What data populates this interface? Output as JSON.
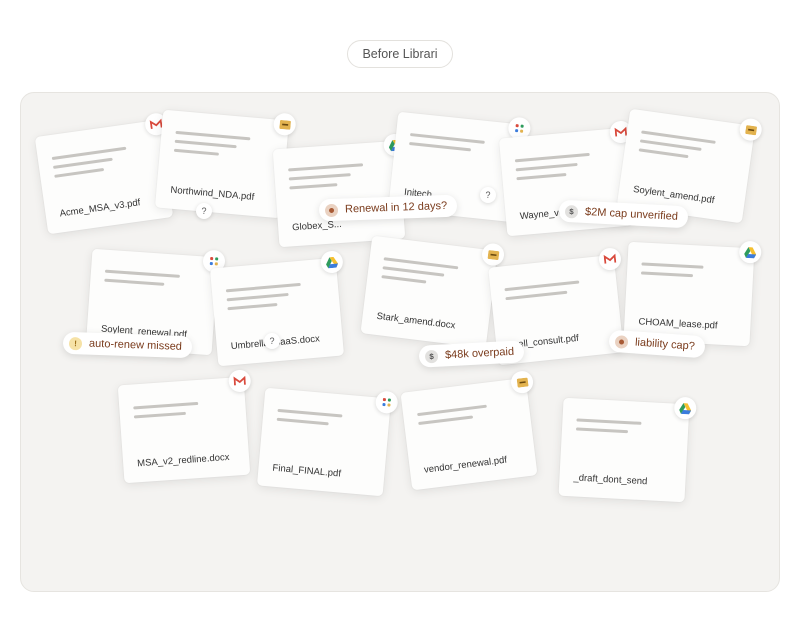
{
  "header": {
    "label": "Before Librari"
  },
  "cards": [
    {
      "filename": "Acme_MSA_v3.pdf",
      "source_icon": "gmail-icon"
    },
    {
      "filename": "Northwind_NDA.pdf",
      "source_icon": "box-icon"
    },
    {
      "filename": "Globex_S...",
      "source_icon": "google-drive-icon"
    },
    {
      "filename": "Initech...",
      "source_icon": "slack-icon"
    },
    {
      "filename": "Wayne_ver...",
      "source_icon": "gmail-icon"
    },
    {
      "filename": "Soylent_amend.pdf",
      "source_icon": "box-icon"
    },
    {
      "filename": "Soylent_renewal.pdf",
      "source_icon": "slack-icon"
    },
    {
      "filename": "Umbrella_SaaS.docx",
      "source_icon": "google-drive-icon"
    },
    {
      "filename": "Stark_amend.docx",
      "source_icon": "box-icon"
    },
    {
      "filename": "...ell_consult.pdf",
      "source_icon": "gmail-icon"
    },
    {
      "filename": "CHOAM_lease.pdf",
      "source_icon": "google-drive-icon"
    },
    {
      "filename": "MSA_v2_redline.docx",
      "source_icon": "gmail-icon"
    },
    {
      "filename": "Final_FINAL.pdf",
      "source_icon": "slack-icon"
    },
    {
      "filename": "vendor_renewal.pdf",
      "source_icon": "box-icon"
    },
    {
      "filename": "_draft_dont_send",
      "source_icon": "google-drive-icon"
    }
  ],
  "alerts": [
    {
      "text": "Renewal in 12 days?",
      "icon": "bell-icon"
    },
    {
      "text": "$2M cap unverified",
      "icon": "dollar-icon"
    },
    {
      "text": "auto-renew missed",
      "icon": "warning-icon"
    },
    {
      "text": "$48k overpaid",
      "icon": "dollar-icon"
    },
    {
      "text": "liability cap?",
      "icon": "bell-icon"
    }
  ],
  "question_mark": "?",
  "colors": {
    "gmail_red": "#d94a3d",
    "box_amber": "#e3b34f",
    "drive_green": "#2f9c5d",
    "drive_yellow": "#f5c02f",
    "drive_blue": "#3b7cdc",
    "alert_text": "#7a3b1c"
  }
}
